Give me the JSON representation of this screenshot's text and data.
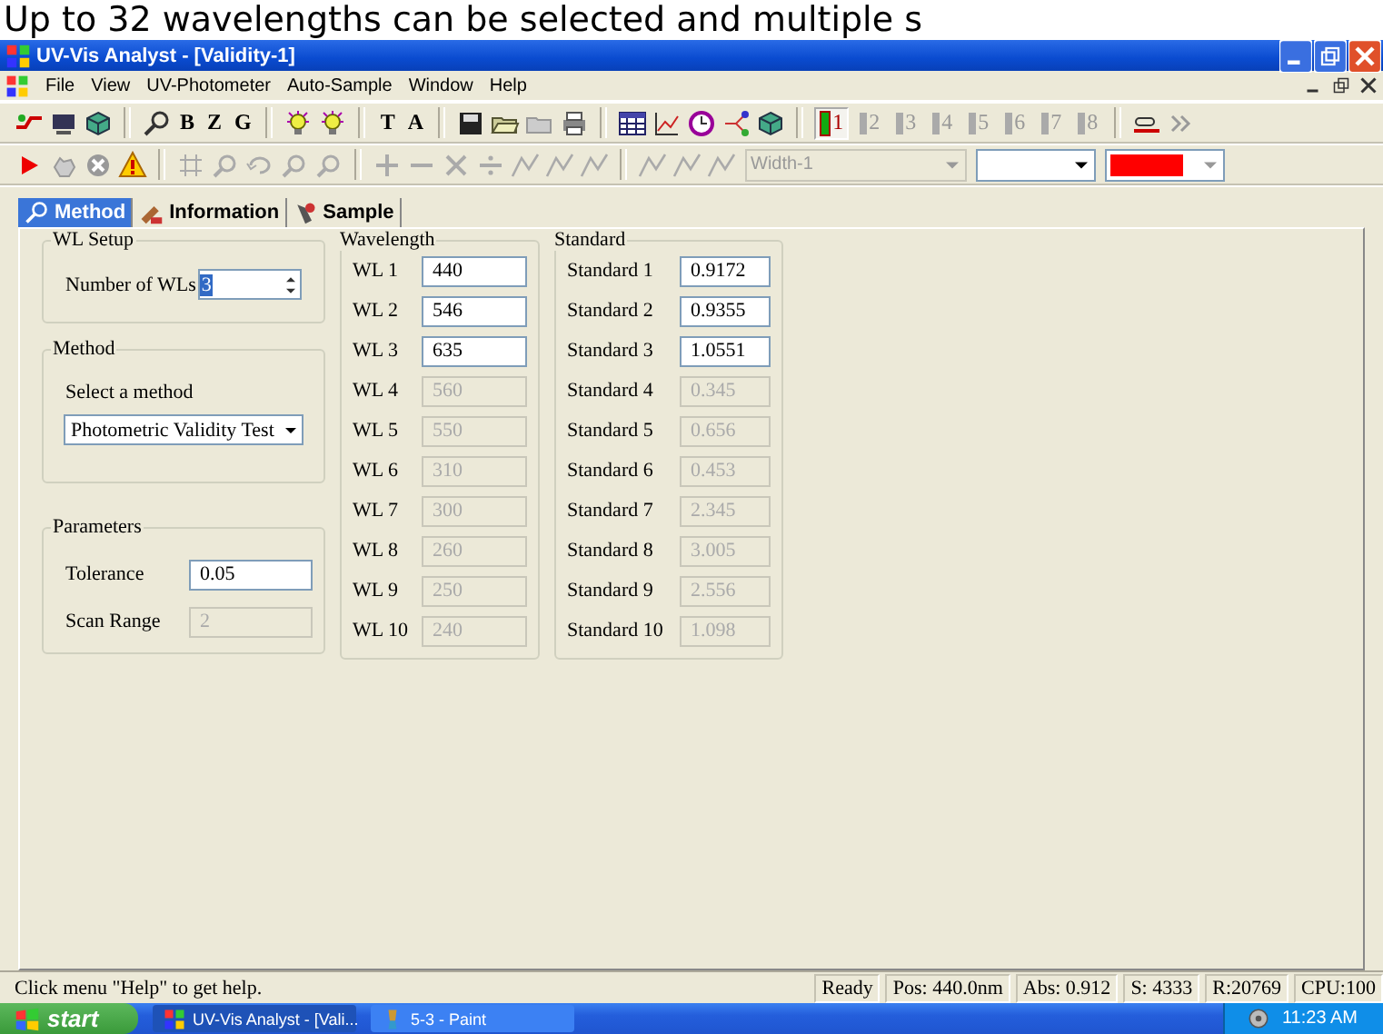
{
  "caption": "Up to 32 wavelengths can be selected and multiple s",
  "window": {
    "title": "UV-Vis Analyst - [Validity-1]"
  },
  "menu": [
    "File",
    "View",
    "UV-Photometer",
    "Auto-Sample",
    "Window",
    "Help"
  ],
  "toolbar_1": [
    {
      "kind": "icon"
    },
    {
      "kind": "icon"
    },
    {
      "kind": "icon"
    },
    {
      "kind": "sep"
    },
    {
      "kind": "icon"
    },
    {
      "kind": "text",
      "text": "B"
    },
    {
      "kind": "text",
      "text": "Z"
    },
    {
      "kind": "text",
      "text": "G"
    },
    {
      "kind": "sep"
    },
    {
      "kind": "icon"
    },
    {
      "kind": "icon"
    },
    {
      "kind": "sep"
    },
    {
      "kind": "text",
      "text": "T"
    },
    {
      "kind": "text",
      "text": "A"
    },
    {
      "kind": "sep"
    },
    {
      "kind": "icon"
    },
    {
      "kind": "icon"
    },
    {
      "kind": "icon"
    },
    {
      "kind": "icon"
    },
    {
      "kind": "sep"
    },
    {
      "kind": "icon"
    },
    {
      "kind": "icon"
    },
    {
      "kind": "icon"
    },
    {
      "kind": "icon"
    },
    {
      "kind": "icon"
    }
  ],
  "channels": [
    {
      "label": "1",
      "selected": true
    },
    {
      "label": "2",
      "selected": false
    },
    {
      "label": "3",
      "selected": false
    },
    {
      "label": "4",
      "selected": false
    },
    {
      "label": "5",
      "selected": false
    },
    {
      "label": "6",
      "selected": false
    },
    {
      "label": "7",
      "selected": false
    },
    {
      "label": "8",
      "selected": false
    }
  ],
  "toolbar_2": [
    {
      "kind": "icon"
    },
    {
      "kind": "icon"
    },
    {
      "kind": "icon"
    },
    {
      "kind": "icon"
    },
    {
      "kind": "sep"
    },
    {
      "kind": "icon"
    },
    {
      "kind": "icon"
    },
    {
      "kind": "icon"
    },
    {
      "kind": "icon"
    },
    {
      "kind": "icon"
    },
    {
      "kind": "sep"
    },
    {
      "kind": "icon"
    },
    {
      "kind": "icon"
    },
    {
      "kind": "icon"
    },
    {
      "kind": "icon"
    },
    {
      "kind": "icon"
    },
    {
      "kind": "icon"
    },
    {
      "kind": "icon"
    },
    {
      "kind": "sep"
    },
    {
      "kind": "icon"
    },
    {
      "kind": "icon"
    },
    {
      "kind": "icon"
    }
  ],
  "line_width": "Width-1",
  "tabs": [
    {
      "label": "Method",
      "selected": true
    },
    {
      "label": "Information",
      "selected": false
    },
    {
      "label": "Sample",
      "selected": false
    }
  ],
  "wl_setup": {
    "title": "WL Setup",
    "label": "Number of WLs",
    "value": "3"
  },
  "method": {
    "title": "Method",
    "label": "Select a method",
    "value": "Photometric Validity Test"
  },
  "parameters": {
    "title": "Parameters",
    "fields": [
      {
        "label": "Tolerance",
        "value": "0.05",
        "disabled": false
      },
      {
        "label": "Scan Range",
        "value": "2",
        "disabled": true
      }
    ]
  },
  "wavelength": {
    "title": "Wavelength",
    "rows": [
      {
        "label": "WL 1",
        "value": "440",
        "disabled": false
      },
      {
        "label": "WL 2",
        "value": "546",
        "disabled": false
      },
      {
        "label": "WL 3",
        "value": "635",
        "disabled": false
      },
      {
        "label": "WL 4",
        "value": "560",
        "disabled": true
      },
      {
        "label": "WL 5",
        "value": "550",
        "disabled": true
      },
      {
        "label": "WL 6",
        "value": "310",
        "disabled": true
      },
      {
        "label": "WL 7",
        "value": "300",
        "disabled": true
      },
      {
        "label": "WL 8",
        "value": "260",
        "disabled": true
      },
      {
        "label": "WL 9",
        "value": "250",
        "disabled": true
      },
      {
        "label": "WL 10",
        "value": "240",
        "disabled": true
      }
    ]
  },
  "standard": {
    "title": "Standard",
    "rows": [
      {
        "label": "Standard 1",
        "value": "0.9172",
        "disabled": false
      },
      {
        "label": "Standard 2",
        "value": "0.9355",
        "disabled": false
      },
      {
        "label": "Standard 3",
        "value": "1.0551",
        "disabled": false
      },
      {
        "label": "Standard 4",
        "value": "0.345",
        "disabled": true
      },
      {
        "label": "Standard 5",
        "value": "0.656",
        "disabled": true
      },
      {
        "label": "Standard 6",
        "value": "0.453",
        "disabled": true
      },
      {
        "label": "Standard 7",
        "value": "2.345",
        "disabled": true
      },
      {
        "label": "Standard 8",
        "value": "3.005",
        "disabled": true
      },
      {
        "label": "Standard 9",
        "value": "2.556",
        "disabled": true
      },
      {
        "label": "Standard 10",
        "value": "1.098",
        "disabled": true
      }
    ]
  },
  "status_bar": {
    "message": "Click menu \"Help\" to get help.",
    "panes": [
      "Ready",
      "Pos: 440.0nm",
      "Abs: 0.912",
      "S: 4333",
      "R:20769",
      "CPU:100"
    ]
  },
  "taskbar": {
    "start": "start",
    "tasks": [
      {
        "label": "UV-Vis Analyst - [Vali...",
        "selected": true
      },
      {
        "label": "5-3 - Paint",
        "selected": false
      }
    ],
    "clock": "11:23 AM"
  }
}
